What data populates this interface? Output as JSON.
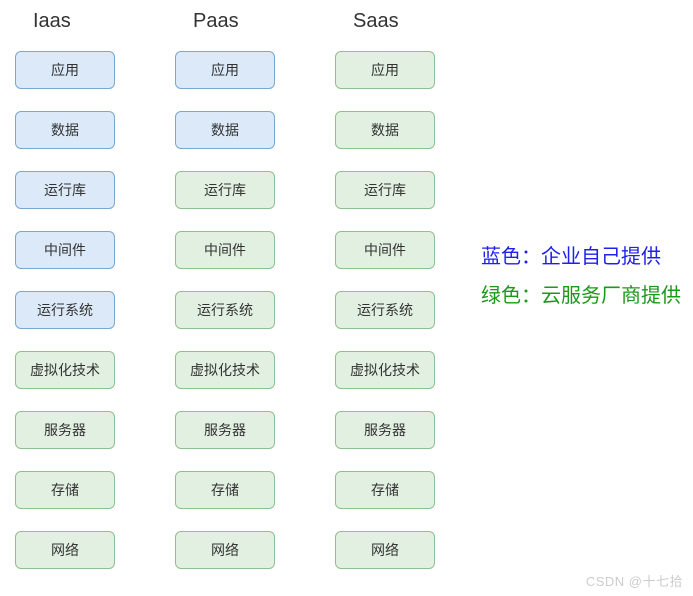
{
  "columns": [
    {
      "title": "Iaas",
      "layers": [
        {
          "label": "应用",
          "color": "blue"
        },
        {
          "label": "数据",
          "color": "blue"
        },
        {
          "label": "运行库",
          "color": "blue"
        },
        {
          "label": "中间件",
          "color": "blue"
        },
        {
          "label": "运行系统",
          "color": "blue"
        },
        {
          "label": "虚拟化技术",
          "color": "green"
        },
        {
          "label": "服务器",
          "color": "green"
        },
        {
          "label": "存储",
          "color": "green"
        },
        {
          "label": "网络",
          "color": "green"
        }
      ]
    },
    {
      "title": "Paas",
      "layers": [
        {
          "label": "应用",
          "color": "blue"
        },
        {
          "label": "数据",
          "color": "blue"
        },
        {
          "label": "运行库",
          "color": "green"
        },
        {
          "label": "中间件",
          "color": "green"
        },
        {
          "label": "运行系统",
          "color": "green"
        },
        {
          "label": "虚拟化技术",
          "color": "green"
        },
        {
          "label": "服务器",
          "color": "green"
        },
        {
          "label": "存储",
          "color": "green"
        },
        {
          "label": "网络",
          "color": "green"
        }
      ]
    },
    {
      "title": "Saas",
      "layers": [
        {
          "label": "应用",
          "color": "green"
        },
        {
          "label": "数据",
          "color": "green"
        },
        {
          "label": "运行库",
          "color": "green"
        },
        {
          "label": "中间件",
          "color": "green"
        },
        {
          "label": "运行系统",
          "color": "green"
        },
        {
          "label": "虚拟化技术",
          "color": "green"
        },
        {
          "label": "服务器",
          "color": "green"
        },
        {
          "label": "存储",
          "color": "green"
        },
        {
          "label": "网络",
          "color": "green"
        }
      ]
    }
  ],
  "legend": {
    "blue": "蓝色：企业自己提供",
    "green": "绿色：云服务厂商提供"
  },
  "watermark": "CSDN @十七拾"
}
